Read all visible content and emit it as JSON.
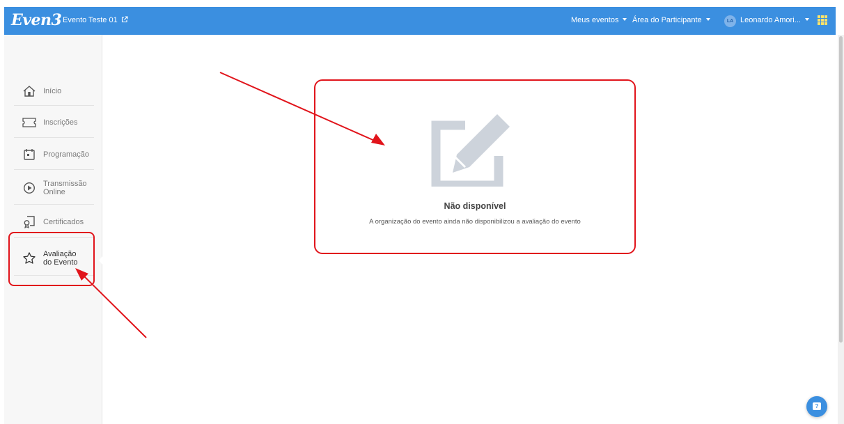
{
  "header": {
    "brand": "Even3",
    "event_title": "Evento Teste 01",
    "nav": [
      {
        "label": "Meus eventos"
      },
      {
        "label": "Área do Participante"
      }
    ],
    "user": {
      "initials": "LA",
      "name": "Leonardo Amori..."
    }
  },
  "sidebar": {
    "items": [
      {
        "label": "Início",
        "icon": "home-icon"
      },
      {
        "label": "Inscrições",
        "icon": "ticket-icon"
      },
      {
        "label": "Programação",
        "icon": "calendar-icon"
      },
      {
        "label": "Transmissão Online",
        "icon": "play-circle-icon"
      },
      {
        "label": "Certificados",
        "icon": "certificate-icon"
      },
      {
        "label": "Avaliação do Evento",
        "icon": "star-icon",
        "active": true
      }
    ]
  },
  "main": {
    "title": "Não disponível",
    "subtitle": "A organização do evento ainda não disponibilizou a avaliação do evento",
    "icon": "edit-icon"
  },
  "colors": {
    "topbar": "#3b8fe0",
    "annotation": "#e1141b",
    "icon_gray": "#cdd3db"
  }
}
